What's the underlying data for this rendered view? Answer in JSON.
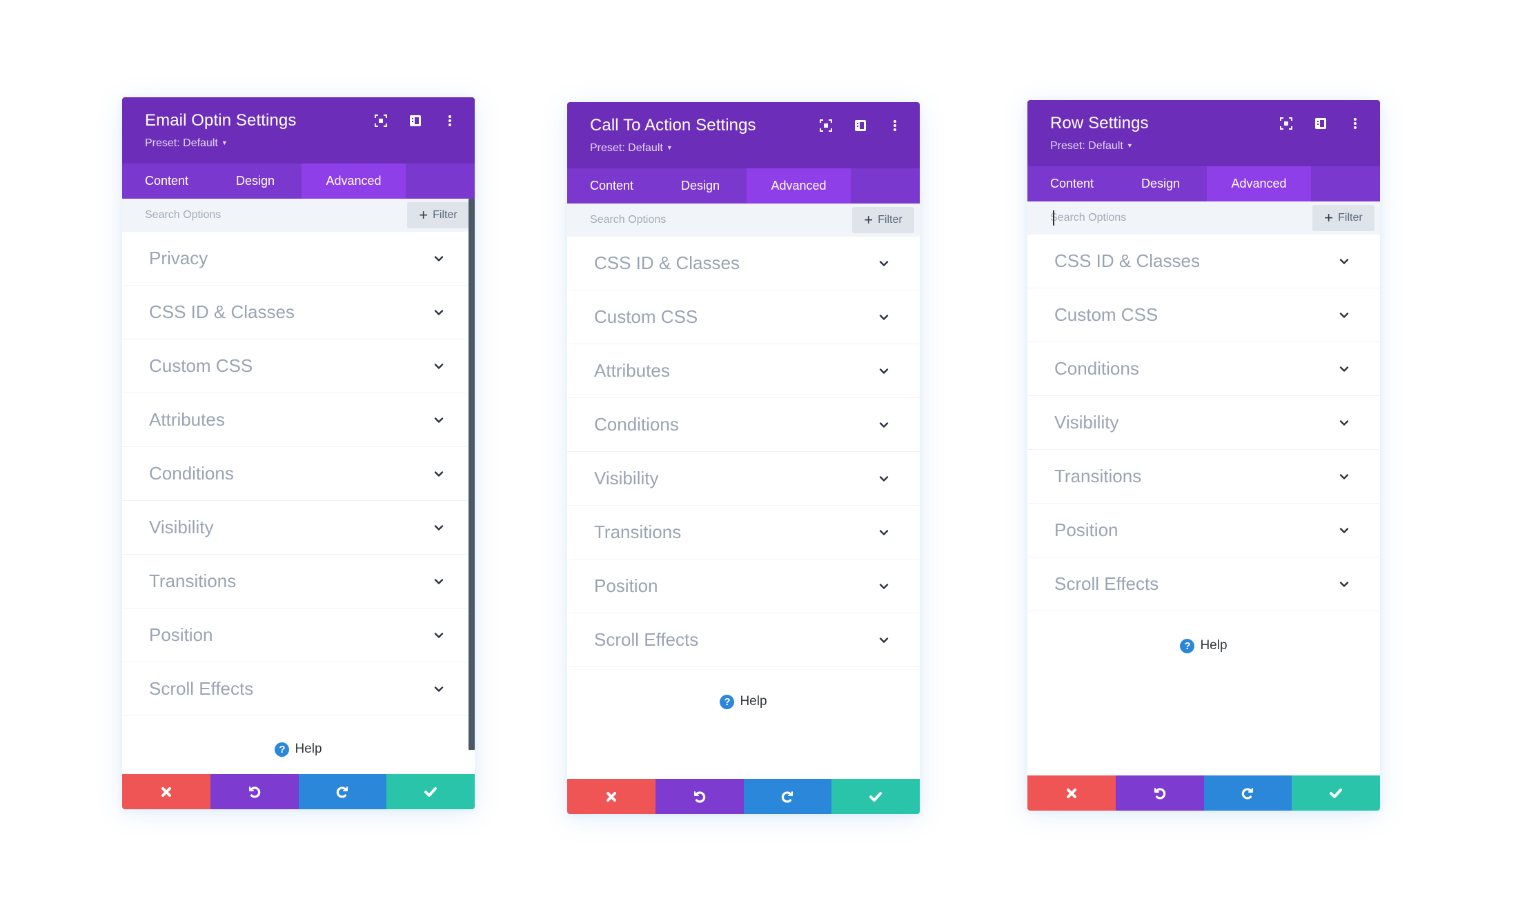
{
  "colors": {
    "header_bg": "#6c2eb9",
    "tabs_bg": "#7b38cf",
    "tab_active_bg": "#8e3fe8",
    "cancel": "#ef5555",
    "undo": "#7e3bd0",
    "redo": "#2b87da",
    "save": "#29c4a9",
    "help_icon": "#2b87da"
  },
  "panels": [
    {
      "title": "Email Optin Settings",
      "preset": "Preset: Default",
      "tabs": [
        {
          "label": "Content",
          "active": false
        },
        {
          "label": "Design",
          "active": false
        },
        {
          "label": "Advanced",
          "active": true
        }
      ],
      "search": {
        "placeholder": "Search Options",
        "value": ""
      },
      "filter_label": "Filter",
      "options": [
        "Privacy",
        "CSS ID & Classes",
        "Custom CSS",
        "Attributes",
        "Conditions",
        "Visibility",
        "Transitions",
        "Position",
        "Scroll Effects"
      ],
      "help_label": "Help",
      "has_scrollbar": true
    },
    {
      "title": "Call To Action Settings",
      "preset": "Preset: Default",
      "tabs": [
        {
          "label": "Content",
          "active": false
        },
        {
          "label": "Design",
          "active": false
        },
        {
          "label": "Advanced",
          "active": true
        }
      ],
      "search": {
        "placeholder": "Search Options",
        "value": ""
      },
      "filter_label": "Filter",
      "options": [
        "CSS ID & Classes",
        "Custom CSS",
        "Attributes",
        "Conditions",
        "Visibility",
        "Transitions",
        "Position",
        "Scroll Effects"
      ],
      "help_label": "Help",
      "has_scrollbar": false
    },
    {
      "title": "Row Settings",
      "preset": "Preset: Default",
      "tabs": [
        {
          "label": "Content",
          "active": false
        },
        {
          "label": "Design",
          "active": false
        },
        {
          "label": "Advanced",
          "active": true
        }
      ],
      "search": {
        "placeholder": "Search Options",
        "value": "",
        "focused": true
      },
      "filter_label": "Filter",
      "options": [
        "CSS ID & Classes",
        "Custom CSS",
        "Conditions",
        "Visibility",
        "Transitions",
        "Position",
        "Scroll Effects"
      ],
      "help_label": "Help",
      "has_scrollbar": false
    }
  ],
  "icons": {
    "header": [
      "focus-mode-icon",
      "split-view-icon",
      "more-options-icon"
    ],
    "row": "chevron-down-icon",
    "help": "help-circle-icon",
    "footer": [
      "close-icon",
      "undo-icon",
      "redo-icon",
      "check-icon"
    ]
  }
}
